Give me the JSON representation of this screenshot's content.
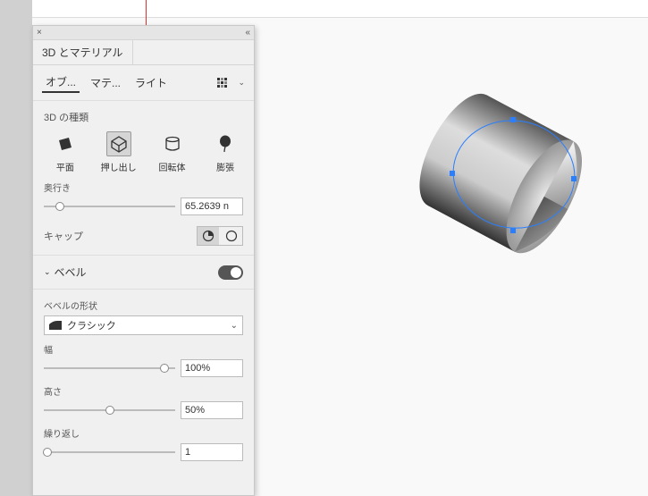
{
  "panel": {
    "title": "3D とマテリアル",
    "close_label": "×",
    "collapse_label": "«"
  },
  "subtabs": {
    "objects": "オブ...",
    "materials": "マテ...",
    "lights": "ライト"
  },
  "type_section": {
    "label": "3D の種類",
    "items": {
      "plane": "平面",
      "extrude": "押し出し",
      "revolve": "回転体",
      "inflate": "膨張"
    }
  },
  "depth": {
    "label": "奥行き",
    "value": "65.2639 n"
  },
  "cap": {
    "label": "キャップ"
  },
  "bevel": {
    "title": "ベベル",
    "shape_label": "ベベルの形状",
    "shape_value": "クラシック",
    "width_label": "幅",
    "width_value": "100%",
    "height_label": "高さ",
    "height_value": "50%",
    "repeat_label": "繰り返し",
    "repeat_value": "1"
  }
}
